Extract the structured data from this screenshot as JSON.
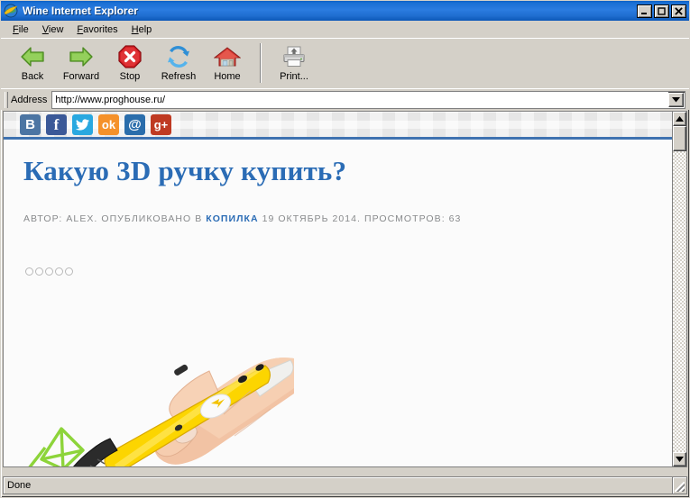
{
  "window": {
    "title": "Wine Internet Explorer",
    "icon": "wine-ie-globe-icon",
    "minimize_label": "Minimize",
    "maximize_label": "Maximize",
    "close_label": "Close"
  },
  "menu": {
    "items": [
      {
        "label": "File",
        "accel": "F",
        "rest": "ile"
      },
      {
        "label": "View",
        "accel": "V",
        "rest": "iew"
      },
      {
        "label": "Favorites",
        "accel": "F",
        "rest": "avorites"
      },
      {
        "label": "Help",
        "accel": "H",
        "rest": "elp"
      }
    ]
  },
  "toolbar": {
    "buttons": [
      {
        "label": "Back",
        "icon": "back-arrow-icon"
      },
      {
        "label": "Forward",
        "icon": "forward-arrow-icon"
      },
      {
        "label": "Stop",
        "icon": "stop-icon"
      },
      {
        "label": "Refresh",
        "icon": "refresh-icon"
      },
      {
        "label": "Home",
        "icon": "home-icon"
      },
      {
        "label": "Print...",
        "icon": "printer-icon"
      }
    ]
  },
  "address": {
    "label": "Address",
    "value": "http://www.proghouse.ru/",
    "placeholder": "http://",
    "dropdown_icon": "chevron-down-icon"
  },
  "page": {
    "social": [
      {
        "name": "vkontakte",
        "glyph": "В",
        "color": "#4c75a3"
      },
      {
        "name": "facebook",
        "glyph": "f",
        "color": "#3b5998"
      },
      {
        "name": "twitter",
        "glyph": "🐦",
        "color": "#29a8e0"
      },
      {
        "name": "odnoklassniki",
        "glyph": "ok",
        "color": "#f5912a"
      },
      {
        "name": "mailru",
        "glyph": "@",
        "color": "#2a6dab"
      },
      {
        "name": "googleplus",
        "glyph": "g+",
        "color": "#bf3a22"
      }
    ],
    "title": "Какую 3D ручку купить?",
    "meta": {
      "author_prefix": "АВТОР: ALEX. ОПУБЛИКОВАНО В ",
      "category": "КОПИЛКА",
      "date_suffix": " 19 ОКТЯБРЬ 2014. ПРОСМОТРОВ: 63"
    },
    "rating": {
      "stars": 5,
      "filled": 0
    },
    "photo_alt": "yellow-3d-pen-in-hand-photo"
  },
  "status": {
    "text": "Done"
  }
}
